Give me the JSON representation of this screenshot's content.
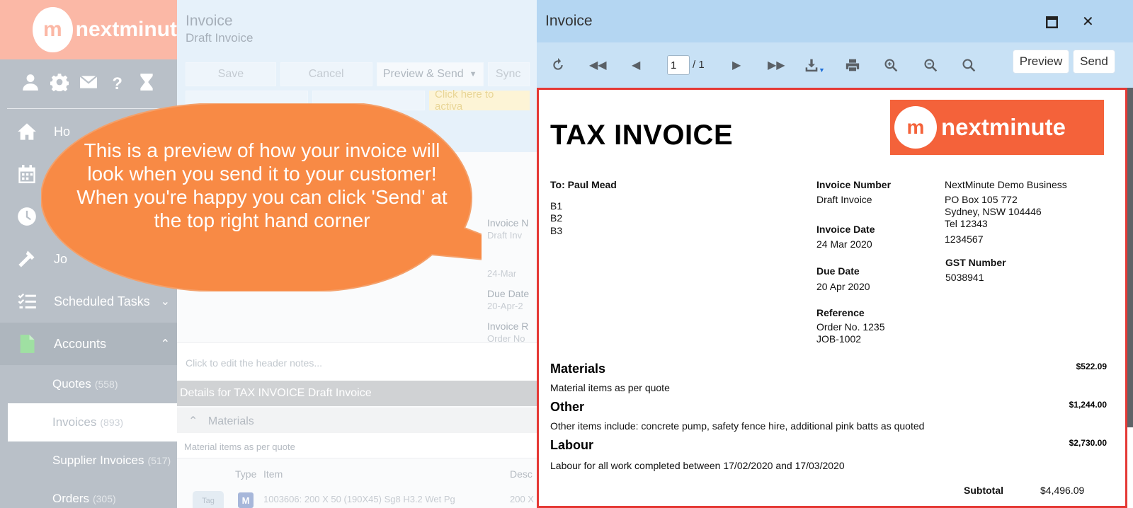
{
  "sidebar": {
    "logo_mark": "m",
    "logo_text": "nextminut",
    "nav_partial": {
      "home": "Ho",
      "jobs": "Jo"
    },
    "scheduled_tasks": "Scheduled Tasks",
    "accounts": "Accounts",
    "sub_items": [
      {
        "label": "Quotes",
        "count": "(558)"
      },
      {
        "label": "Invoices",
        "count": "(893)"
      },
      {
        "label": "Supplier Invoices",
        "count": "(517)"
      },
      {
        "label": "Orders",
        "count": "(305)"
      }
    ]
  },
  "background": {
    "title": "Invoice",
    "subtitle": "Draft Invoice",
    "toolbar": {
      "save": "Save",
      "cancel": "Cancel",
      "preview_send": "Preview & Send",
      "sync": "Sync"
    },
    "activate_banner": "Click here to activa",
    "fields": {
      "invoice_number_label": "Invoice N",
      "invoice_number_value": "Draft Inv",
      "invoice_date_value": "24-Mar",
      "due_date_label": "Due Date",
      "due_date_value": "20-Apr-2",
      "reference_label": "Invoice R",
      "reference_value": "Order No"
    },
    "header_notes": "Click to edit the header notes...",
    "details_header": "Details for TAX INVOICE Draft Invoice",
    "materials_section": "Materials",
    "materials_note": "Material items as per quote",
    "columns": {
      "type": "Type",
      "item": "Item",
      "desc": "Desc"
    },
    "line_item": {
      "tag": "Tag",
      "badge": "M",
      "item": "1003606: 200 X 50 (190X45) Sg8 H3.2 Wet Pg",
      "desc": "200 X"
    }
  },
  "preview_window": {
    "title": "Invoice",
    "toolbar": {
      "page_current": "1",
      "page_total": "/ 1",
      "preview_label": "Preview",
      "send_label": "Send"
    },
    "document": {
      "heading": "TAX INVOICE",
      "logo_mark": "m",
      "logo_text": "nextminute",
      "to": "To: Paul Mead",
      "address_lines": [
        "B1",
        "B2",
        "B3"
      ],
      "invoice_number_label": "Invoice Number",
      "invoice_number": "Draft Invoice",
      "invoice_date_label": "Invoice Date",
      "invoice_date": "24 Mar 2020",
      "due_date_label": "Due Date",
      "due_date": "20 Apr 2020",
      "reference_label": "Reference",
      "reference_lines": [
        "Order No. 1235",
        "JOB-1002"
      ],
      "business": {
        "name": "NextMinute Demo Business",
        "address1": "PO Box 105 772",
        "address2": "Sydney, NSW 104446",
        "tel": "Tel 12343",
        "phone2": "1234567",
        "gst_label": "GST Number",
        "gst_number": "5038941"
      },
      "sections": [
        {
          "title": "Materials",
          "amount": "$522.09",
          "note": "Material items as per quote"
        },
        {
          "title": "Other",
          "amount": "$1,244.00",
          "note": "Other items include: concrete pump, safety fence hire, additional pink batts as quoted"
        },
        {
          "title": "Labour",
          "amount": "$2,730.00",
          "note": "Labour for all work completed between 17/02/2020 and 17/03/2020"
        }
      ],
      "subtotal_label": "Subtotal",
      "subtotal": "$4,496.09"
    }
  },
  "callout": {
    "text": "This is a preview of how your invoice will look when you send it to your customer! When you're happy you can click 'Send' at the top right hand corner"
  },
  "colors": {
    "brand_orange": "#f4623a",
    "callout_orange": "#f88a45",
    "title_bar": "#b4d6f2",
    "highlight_red": "#e53935"
  }
}
